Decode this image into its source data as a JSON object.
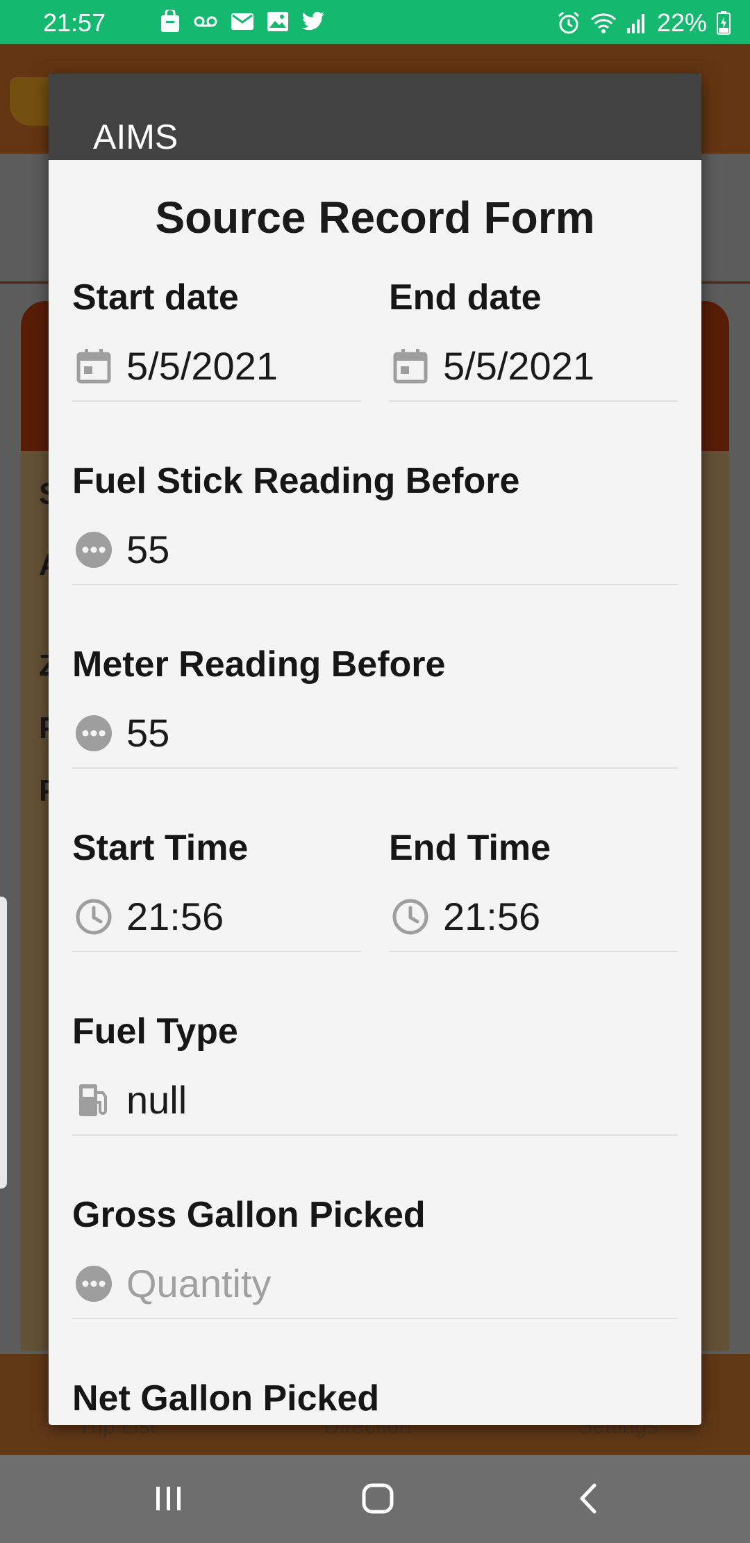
{
  "status_bar": {
    "time": "21:57",
    "battery": "22%",
    "notification_icons": [
      "shopping-bag-icon",
      "voicemail-icon",
      "mail-icon",
      "image-icon",
      "twitter-icon"
    ],
    "system_icons": [
      "alarm-icon",
      "wifi-icon",
      "signal-icon",
      "battery-charging-icon"
    ]
  },
  "background_app": {
    "tabs": [
      "Trip List",
      "Direction",
      "Settings"
    ],
    "card_letters": [
      "S",
      "A",
      "Z",
      "P",
      "P"
    ]
  },
  "dialog": {
    "title": "AIMS",
    "form_title": "Source Record Form",
    "fields": {
      "start_date": {
        "label": "Start date",
        "value": "5/5/2021",
        "icon": "calendar-icon"
      },
      "end_date": {
        "label": "End date",
        "value": "5/5/2021",
        "icon": "calendar-icon"
      },
      "fuel_stick_before": {
        "label": "Fuel Stick Reading Before",
        "value": "55",
        "icon": "more-icon"
      },
      "meter_before": {
        "label": "Meter Reading Before",
        "value": "55",
        "icon": "more-icon"
      },
      "start_time": {
        "label": "Start Time",
        "value": "21:56",
        "icon": "clock-icon"
      },
      "end_time": {
        "label": "End Time",
        "value": "21:56",
        "icon": "clock-icon"
      },
      "fuel_type": {
        "label": "Fuel Type",
        "value": "null",
        "icon": "fuel-pump-icon"
      },
      "gross_gallon": {
        "label": "Gross Gallon Picked",
        "placeholder": "Quantity",
        "icon": "more-icon"
      },
      "net_gallon": {
        "label": "Net Gallon Picked"
      }
    }
  },
  "colors": {
    "status_bar": "#14b86e",
    "dialog_header": "#424242",
    "dialog_body": "#f4f4f4",
    "icon_gray": "#9e9e9e"
  }
}
